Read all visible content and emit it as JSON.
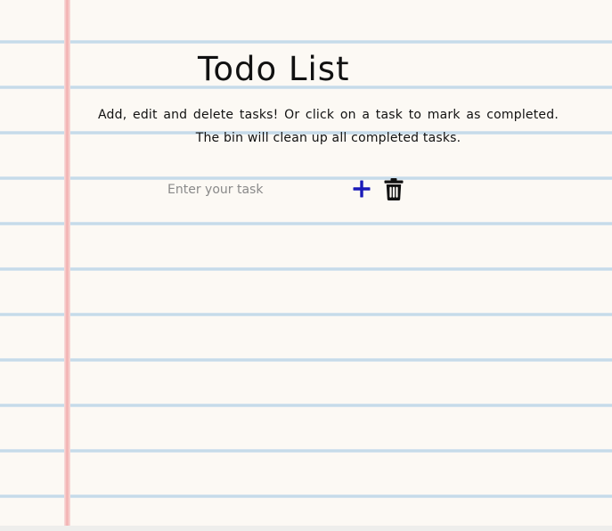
{
  "header": {
    "title": "Todo List",
    "instructions": "Add, edit and delete tasks! Or click on a task to mark as completed. The bin will clean up all completed tasks."
  },
  "task_form": {
    "input_placeholder": "Enter your task",
    "input_value": "",
    "add_icon": "plus-icon",
    "clear_icon": "trash-icon"
  },
  "tasks": [],
  "colors": {
    "paper": "#fcf9f4",
    "rule_line": "#c6dbe9",
    "margin_line": "#f2aeae",
    "add_icon": "#1a1ab8",
    "bin_icon": "#111111"
  }
}
